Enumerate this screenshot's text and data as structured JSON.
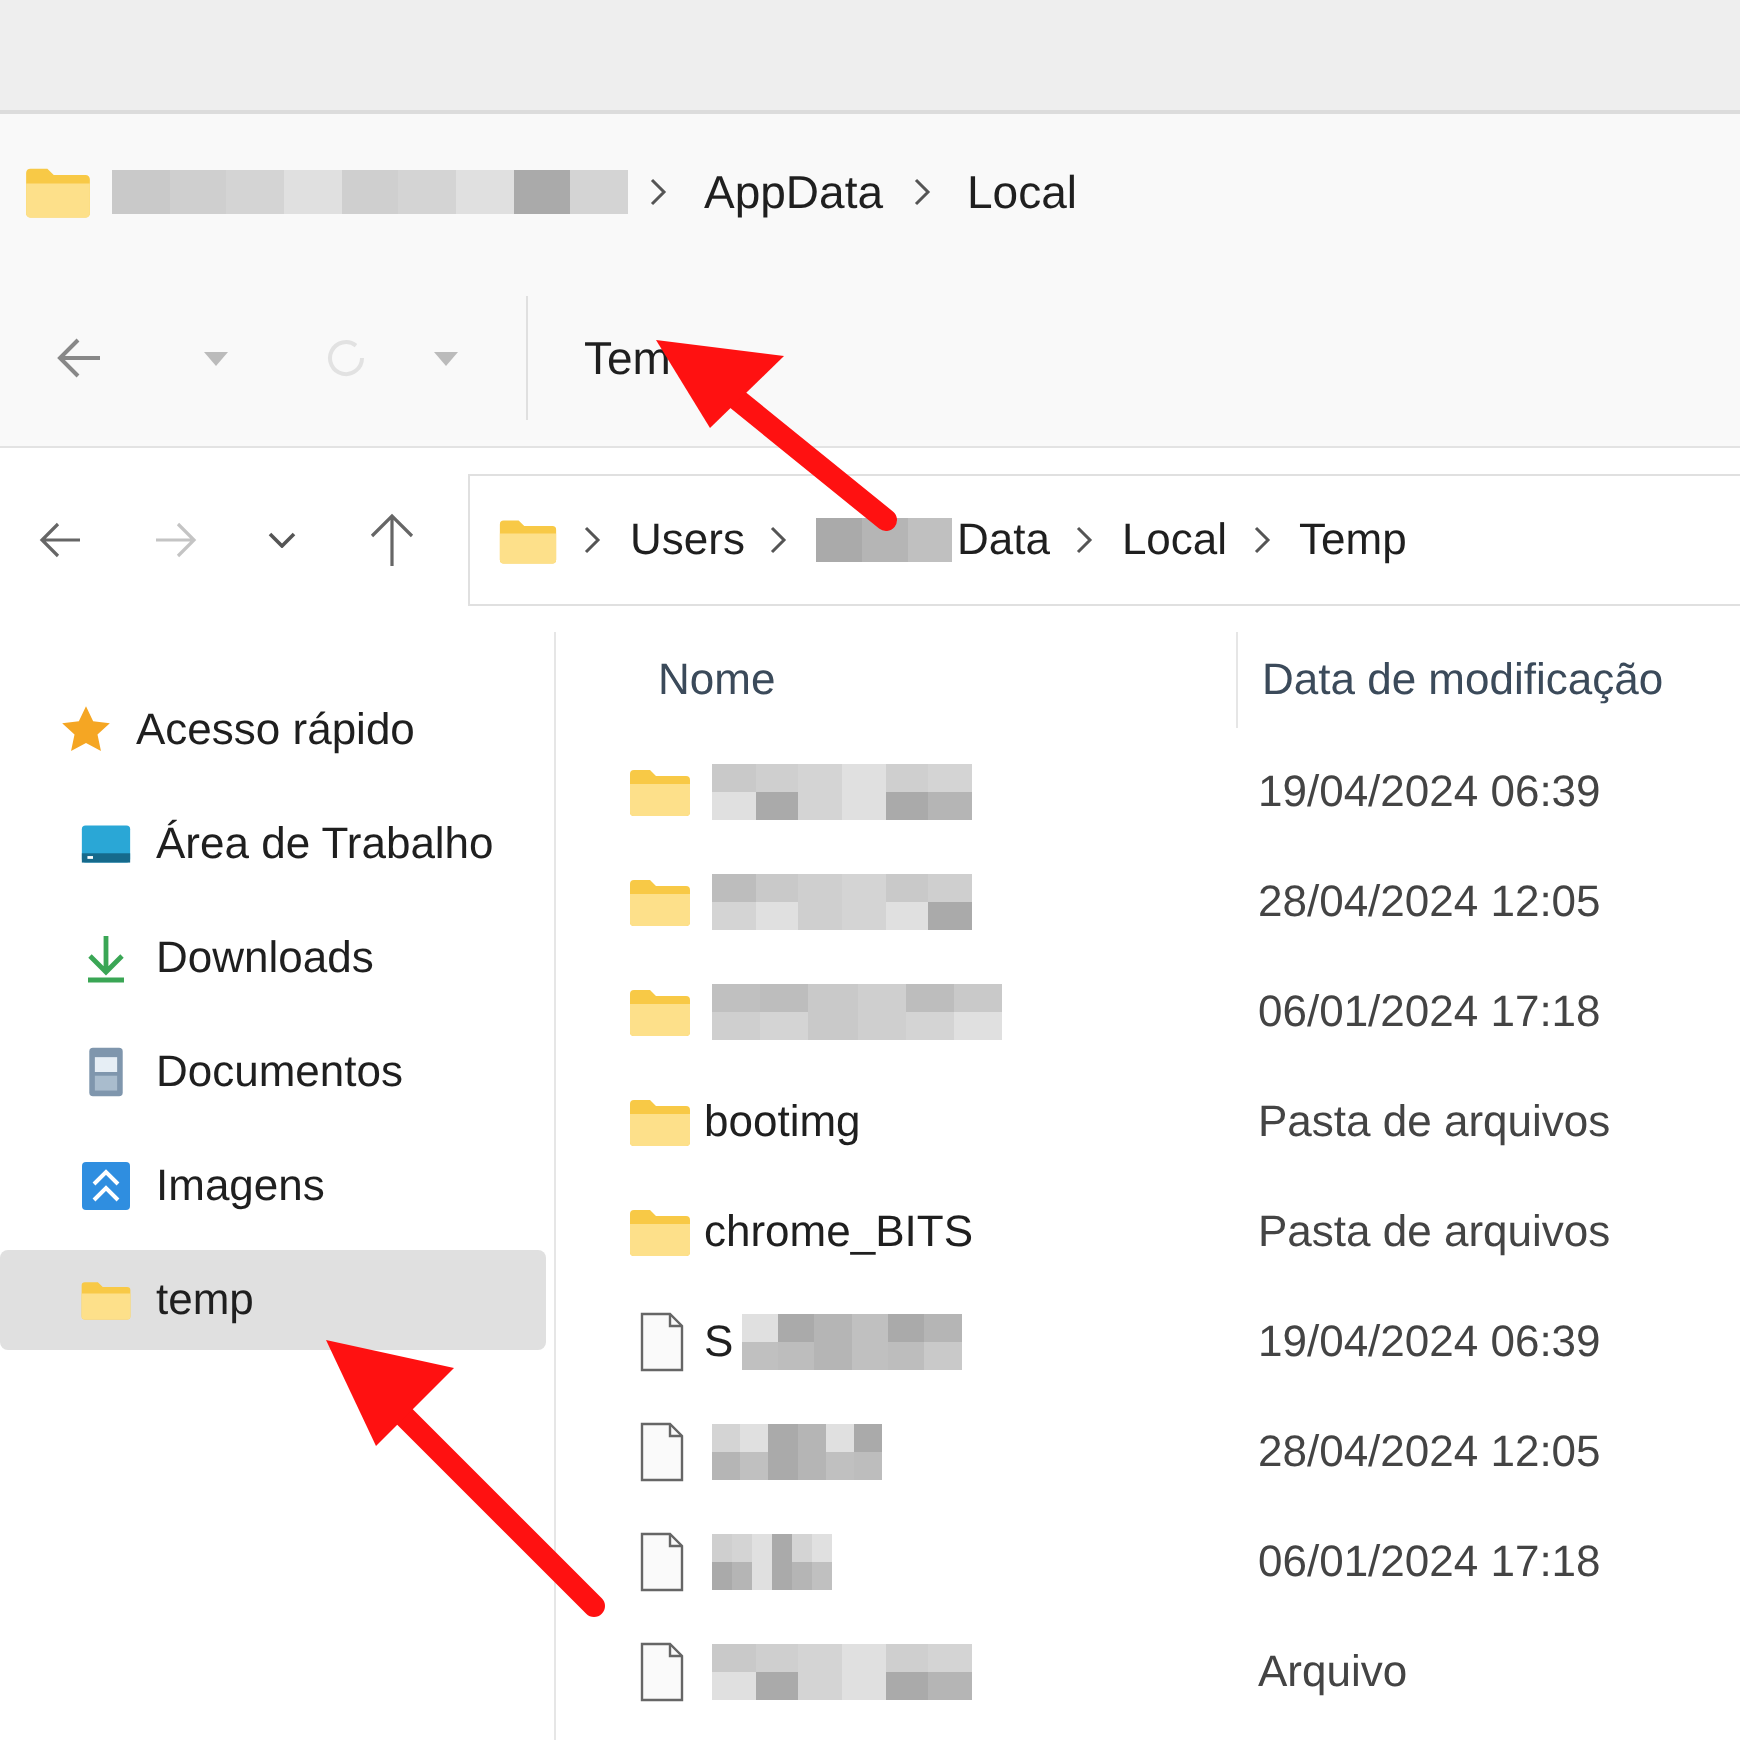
{
  "breadcrumb": [
    {
      "redacted": true
    },
    {
      "label": "AppData"
    },
    {
      "label": "Local"
    }
  ],
  "toolbar": {
    "title": "Tem"
  },
  "address_bar": {
    "path": [
      {
        "label": "Users"
      },
      {
        "label": "Data",
        "redacted": true
      },
      {
        "label": "Local"
      },
      {
        "label": "Temp"
      }
    ]
  },
  "sidebar": {
    "items": [
      {
        "label": "Acesso rápido",
        "kind": "star",
        "selected": false,
        "children": [
          {
            "label": "Área de Trabalho",
            "kind": "desktop",
            "selected": false
          },
          {
            "label": "Downloads",
            "kind": "download",
            "selected": false
          },
          {
            "label": "Documentos",
            "kind": "documents",
            "selected": false
          },
          {
            "label": "Imagens",
            "kind": "pictures",
            "selected": false
          },
          {
            "label": "temp",
            "kind": "folder",
            "selected": true
          }
        ]
      }
    ]
  },
  "file_list": {
    "columns": [
      "Nome",
      "Data de modificação"
    ],
    "rows": [
      {
        "kind": "folder",
        "redacted": true,
        "modified": "19/04/2024 06:39"
      },
      {
        "kind": "folder",
        "redacted": true,
        "modified": "28/04/2024 12:05"
      },
      {
        "kind": "folder",
        "redacted": true,
        "modified": "06/01/2024 17:18"
      },
      {
        "kind": "folder",
        "name": "bootimg",
        "modified": "Pasta de arquivos"
      },
      {
        "kind": "folder",
        "name": "chrome_BITS",
        "modified": "Pasta de arquivos"
      },
      {
        "kind": "file",
        "name": "S",
        "redacted": true,
        "modified": "19/04/2024 06:39"
      },
      {
        "kind": "file",
        "redacted": true,
        "modified": "28/04/2024 12:05"
      },
      {
        "kind": "file",
        "redacted": true,
        "modified": "06/01/2024 17:18"
      },
      {
        "kind": "file",
        "redacted": true,
        "modified": "Arquivo"
      }
    ]
  }
}
